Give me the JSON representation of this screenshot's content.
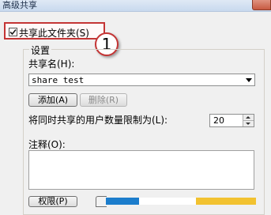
{
  "window": {
    "title": "高级共享"
  },
  "share_checkbox": {
    "label": "共享此文件夹(S)",
    "checked": true
  },
  "callout": {
    "number": "1"
  },
  "settings": {
    "group_title": "设置",
    "share_name_label": "共享名(H):",
    "share_name_value": "share test",
    "add_button": "添加(A)",
    "remove_button": "删除(R)",
    "limit_label": "将同时共享的用户数量限制为(L):",
    "limit_value": "20",
    "comment_label": "注释(O):",
    "comment_value": "",
    "permissions_button": "权限(P)"
  },
  "colors": {
    "highlight": "#c43535",
    "title_bar": "#c8d9ee"
  }
}
